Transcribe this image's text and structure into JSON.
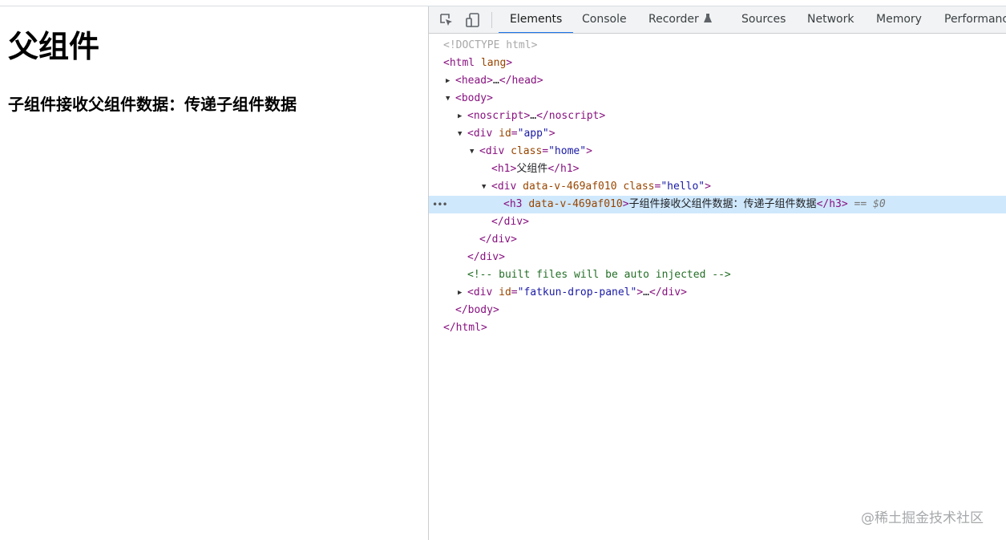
{
  "page": {
    "heading": "父组件",
    "subheading": "子组件接收父组件数据：传递子组件数据"
  },
  "devtools": {
    "tabs": [
      {
        "label": "Elements",
        "active": true
      },
      {
        "label": "Console",
        "active": false
      },
      {
        "label": "Recorder",
        "active": false
      },
      {
        "label": "Sources",
        "active": false
      },
      {
        "label": "Network",
        "active": false
      },
      {
        "label": "Memory",
        "active": false
      },
      {
        "label": "Performance",
        "active": false
      }
    ],
    "dom": {
      "doctype": "<!DOCTYPE html>",
      "html_open": "html",
      "lang_attr": "lang",
      "head_tag": "head",
      "head_close": "head",
      "body_tag": "body",
      "noscript_tag": "noscript",
      "noscript_close": "noscript",
      "div_tag": "div",
      "id_attr": "id",
      "app_id": "\"app\"",
      "class_attr": "class",
      "home_class": "\"home\"",
      "h1_tag": "h1",
      "h1_text": "父组件",
      "data_attr": "data-v-469af010",
      "hello_class": "\"hello\"",
      "h3_tag": "h3",
      "h3_text": "子组件接收父组件数据：传递子组件数据",
      "selected_marker": "== $0",
      "comment": "<!-- built files will be auto injected -->",
      "fatkun_id": "\"fatkun-drop-panel\"",
      "ellipsis": "…",
      "row_dots": "•••"
    }
  },
  "watermark": "@稀土掘金技术社区"
}
